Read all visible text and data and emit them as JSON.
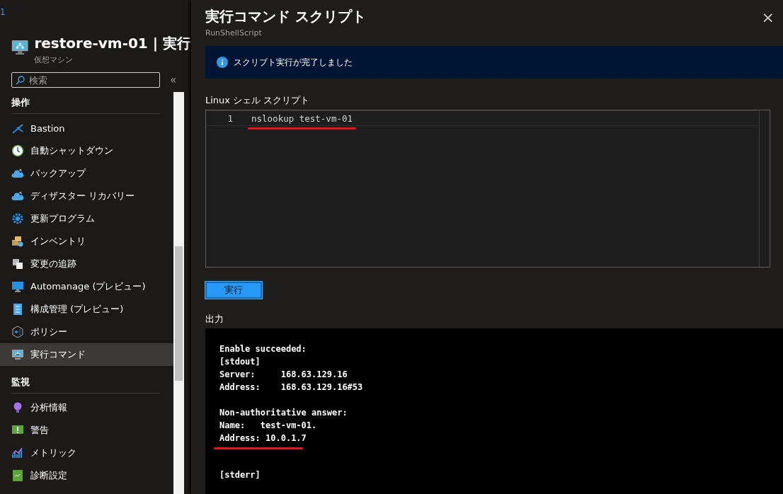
{
  "breadcrumb": "1",
  "resource": {
    "title": "restore-vm-01 | 実行",
    "subtitle": "仮想マシン"
  },
  "search": {
    "placeholder": "検索"
  },
  "collapse_button": "«",
  "sidebar": [
    {
      "heading": "操作",
      "items": [
        {
          "label": "Bastion",
          "kind": "bastion",
          "selected": false
        },
        {
          "label": "自動シャットダウン",
          "kind": "clock",
          "selected": false
        },
        {
          "label": "バックアップ",
          "kind": "cloud",
          "selected": false
        },
        {
          "label": "ディザスター リカバリー",
          "kind": "cloud",
          "selected": false
        },
        {
          "label": "更新プログラム",
          "kind": "gear",
          "selected": false
        },
        {
          "label": "インベントリ",
          "kind": "boxes",
          "selected": false
        },
        {
          "label": "変更の追跡",
          "kind": "pages",
          "selected": false
        },
        {
          "label": "Automanage (プレビュー)",
          "kind": "monitor",
          "selected": false
        },
        {
          "label": "構成管理 (プレビュー)",
          "kind": "list",
          "selected": false
        },
        {
          "label": "ポリシー",
          "kind": "policy",
          "selected": false
        },
        {
          "label": "実行コマンド",
          "kind": "vm",
          "selected": true
        }
      ]
    },
    {
      "heading": "監視",
      "items": [
        {
          "label": "分析情報",
          "kind": "bulb",
          "selected": false
        },
        {
          "label": "警告",
          "kind": "alert",
          "selected": false
        },
        {
          "label": "メトリック",
          "kind": "chart",
          "selected": false
        },
        {
          "label": "診断設定",
          "kind": "diag",
          "selected": false
        }
      ]
    }
  ],
  "panel": {
    "title": "実行コマンド スクリプト",
    "subtitle": "RunShellScript",
    "close": "×",
    "notice": "スクリプト実行が完了しました",
    "editor_label": "Linux シェル スクリプト",
    "code_lines": [
      {
        "number": "1",
        "text": "nslookup test-vm-01",
        "underlined": true
      }
    ],
    "run_button": "実行",
    "output_label": "出力",
    "output_groups": [
      {
        "lines": [
          {
            "text": "Enable succeeded:",
            "underlined": false
          },
          {
            "text": "[stdout]",
            "underlined": false
          },
          {
            "text": "Server:     168.63.129.16",
            "underlined": false
          },
          {
            "text": "Address:    168.63.129.16#53",
            "underlined": false
          }
        ]
      },
      {
        "lines": [
          {
            "text": "Non-authoritative answer:",
            "underlined": false
          },
          {
            "text": "Name:   test-vm-01.",
            "underlined": false
          },
          {
            "text": "Address: 10.0.1.7",
            "underlined": true
          }
        ]
      },
      {
        "lines": [
          {
            "text": "[stderr]",
            "underlined": false
          }
        ]
      }
    ]
  }
}
